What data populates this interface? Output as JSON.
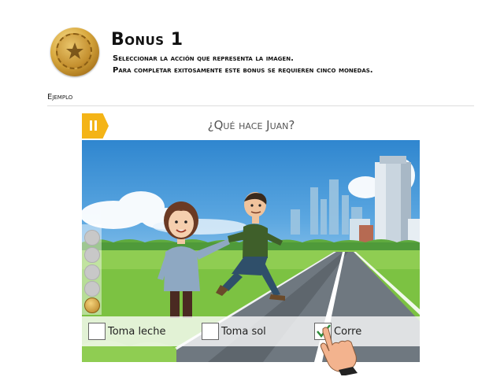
{
  "header": {
    "title": "Bonus 1",
    "subtitle_1": "Seleccionar la acción que representa la imagen.",
    "subtitle_2": "Para completar exitosamente este bonus se requieren cinco monedas."
  },
  "example_label": "Ejemplo",
  "game": {
    "question": "¿Qué hace Juan?",
    "pause_icon": "pause-icon",
    "progress_dots": 4,
    "options": [
      {
        "label": "Toma leche",
        "checked": false
      },
      {
        "label": "Toma sol",
        "checked": false
      },
      {
        "label": "Corre",
        "checked": true
      }
    ]
  },
  "colors": {
    "accent": "#f4b417",
    "check": "#2e8b3a",
    "sky": "#5aa6e0",
    "grass": "#7cc242"
  }
}
